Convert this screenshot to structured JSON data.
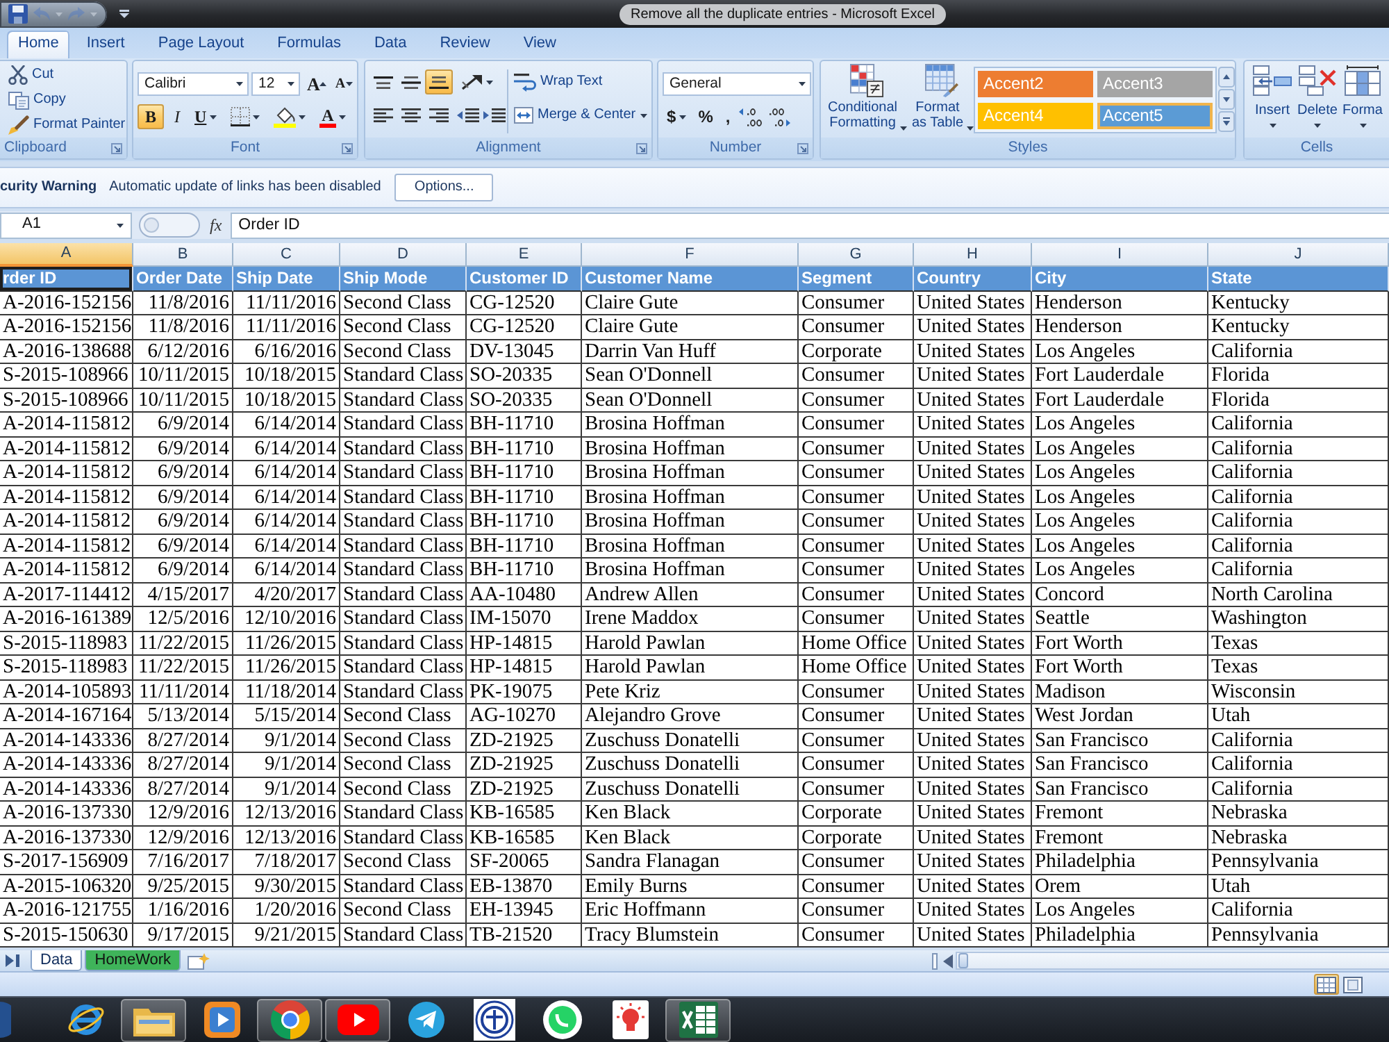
{
  "title_bar": {
    "title": "Remove all the duplicate entries - Microsoft Excel",
    "quick_access": [
      {
        "kind": "save",
        "disabled": false
      },
      {
        "kind": "undo",
        "disabled": true
      },
      {
        "kind": "redo",
        "disabled": true
      }
    ]
  },
  "ribbon": {
    "tabs": [
      {
        "label": "Home",
        "selected": true
      },
      {
        "label": "Insert",
        "selected": false
      },
      {
        "label": "Page Layout",
        "selected": false
      },
      {
        "label": "Formulas",
        "selected": false
      },
      {
        "label": "Data",
        "selected": false
      },
      {
        "label": "Review",
        "selected": false
      },
      {
        "label": "View",
        "selected": false
      }
    ],
    "clipboard": {
      "label": "Clipboard",
      "commands": [
        {
          "kind": "cut",
          "label": "Cut"
        },
        {
          "kind": "copy",
          "label": "Copy"
        },
        {
          "kind": "format_painter",
          "label": "Format Painter"
        }
      ]
    },
    "font": {
      "label": "Font",
      "font_name": "Calibri",
      "font_size": "12",
      "grow_label": "A",
      "shrink_label": "A",
      "styles": [
        {
          "kind": "bold",
          "label": "B",
          "selected": true
        },
        {
          "kind": "italic",
          "label": "I",
          "selected": false
        },
        {
          "kind": "underline",
          "label": "U",
          "selected": false
        }
      ],
      "font_color_label": "A"
    },
    "alignment": {
      "label": "Alignment",
      "vertical": [
        {
          "kind": "top",
          "selected": false
        },
        {
          "kind": "middle",
          "selected": false
        },
        {
          "kind": "bottom",
          "selected": true
        }
      ],
      "horizontal": [
        {
          "kind": "left",
          "selected": false
        },
        {
          "kind": "center",
          "selected": false
        },
        {
          "kind": "right",
          "selected": false
        }
      ],
      "wrap_text": "Wrap Text",
      "merge": "Merge & Center"
    },
    "number": {
      "label": "Number",
      "format": "General",
      "symbols": [
        {
          "kind": "currency",
          "label": "$"
        },
        {
          "kind": "percent",
          "label": "%"
        },
        {
          "kind": "comma",
          "label": ","
        }
      ]
    },
    "styles": {
      "label": "Styles",
      "conditional": "Conditional Formatting",
      "format_table": "Format as Table",
      "gallery": [
        {
          "label": "Accent2",
          "color": "#ed7d31",
          "selected": false
        },
        {
          "label": "Accent3",
          "color": "#a5a5a5",
          "selected": false
        },
        {
          "label": "Accent4",
          "color": "#ffc000",
          "selected": false
        },
        {
          "label": "Accent5",
          "color": "#5b9bd5",
          "selected": true
        }
      ]
    },
    "cells": {
      "label": "Cells",
      "commands": [
        {
          "kind": "insert",
          "label": "Insert"
        },
        {
          "kind": "delete",
          "label": "Delete"
        },
        {
          "kind": "format",
          "label": "Forma"
        }
      ]
    }
  },
  "security_bar": {
    "title": "curity Warning",
    "message": "Automatic update of links has been disabled",
    "button": "Options..."
  },
  "formula_bar": {
    "name_box": "A1",
    "function_label": "fx",
    "content": "Order ID"
  },
  "sheet": {
    "columns": [
      {
        "letter": "A",
        "header": "rder ID",
        "kind": "text",
        "selected": true
      },
      {
        "letter": "B",
        "header": "Order Date",
        "kind": "date",
        "selected": false
      },
      {
        "letter": "C",
        "header": "Ship Date",
        "kind": "date",
        "selected": false
      },
      {
        "letter": "D",
        "header": "Ship Mode",
        "kind": "text",
        "selected": false
      },
      {
        "letter": "E",
        "header": "Customer ID",
        "kind": "text",
        "selected": false
      },
      {
        "letter": "F",
        "header": "Customer Name",
        "kind": "text",
        "selected": false
      },
      {
        "letter": "G",
        "header": "Segment",
        "kind": "text",
        "selected": false
      },
      {
        "letter": "H",
        "header": "Country",
        "kind": "text",
        "selected": false
      },
      {
        "letter": "I",
        "header": "City",
        "kind": "text",
        "selected": false
      },
      {
        "letter": "J",
        "header": "State",
        "kind": "text",
        "selected": false
      }
    ],
    "rows": [
      [
        "A-2016-152156",
        "11/8/2016",
        "11/11/2016",
        "Second Class",
        "CG-12520",
        "Claire Gute",
        "Consumer",
        "United States",
        "Henderson",
        "Kentucky"
      ],
      [
        "A-2016-152156",
        "11/8/2016",
        "11/11/2016",
        "Second Class",
        "CG-12520",
        "Claire Gute",
        "Consumer",
        "United States",
        "Henderson",
        "Kentucky"
      ],
      [
        "A-2016-138688",
        "6/12/2016",
        "6/16/2016",
        "Second Class",
        "DV-13045",
        "Darrin Van Huff",
        "Corporate",
        "United States",
        "Los Angeles",
        "California"
      ],
      [
        "S-2015-108966",
        "10/11/2015",
        "10/18/2015",
        "Standard Class",
        "SO-20335",
        "Sean O'Donnell",
        "Consumer",
        "United States",
        "Fort Lauderdale",
        "Florida"
      ],
      [
        "S-2015-108966",
        "10/11/2015",
        "10/18/2015",
        "Standard Class",
        "SO-20335",
        "Sean O'Donnell",
        "Consumer",
        "United States",
        "Fort Lauderdale",
        "Florida"
      ],
      [
        "A-2014-115812",
        "6/9/2014",
        "6/14/2014",
        "Standard Class",
        "BH-11710",
        "Brosina Hoffman",
        "Consumer",
        "United States",
        "Los Angeles",
        "California"
      ],
      [
        "A-2014-115812",
        "6/9/2014",
        "6/14/2014",
        "Standard Class",
        "BH-11710",
        "Brosina Hoffman",
        "Consumer",
        "United States",
        "Los Angeles",
        "California"
      ],
      [
        "A-2014-115812",
        "6/9/2014",
        "6/14/2014",
        "Standard Class",
        "BH-11710",
        "Brosina Hoffman",
        "Consumer",
        "United States",
        "Los Angeles",
        "California"
      ],
      [
        "A-2014-115812",
        "6/9/2014",
        "6/14/2014",
        "Standard Class",
        "BH-11710",
        "Brosina Hoffman",
        "Consumer",
        "United States",
        "Los Angeles",
        "California"
      ],
      [
        "A-2014-115812",
        "6/9/2014",
        "6/14/2014",
        "Standard Class",
        "BH-11710",
        "Brosina Hoffman",
        "Consumer",
        "United States",
        "Los Angeles",
        "California"
      ],
      [
        "A-2014-115812",
        "6/9/2014",
        "6/14/2014",
        "Standard Class",
        "BH-11710",
        "Brosina Hoffman",
        "Consumer",
        "United States",
        "Los Angeles",
        "California"
      ],
      [
        "A-2014-115812",
        "6/9/2014",
        "6/14/2014",
        "Standard Class",
        "BH-11710",
        "Brosina Hoffman",
        "Consumer",
        "United States",
        "Los Angeles",
        "California"
      ],
      [
        "A-2017-114412",
        "4/15/2017",
        "4/20/2017",
        "Standard Class",
        "AA-10480",
        "Andrew Allen",
        "Consumer",
        "United States",
        "Concord",
        "North Carolina"
      ],
      [
        "A-2016-161389",
        "12/5/2016",
        "12/10/2016",
        "Standard Class",
        "IM-15070",
        "Irene Maddox",
        "Consumer",
        "United States",
        "Seattle",
        "Washington"
      ],
      [
        "S-2015-118983",
        "11/22/2015",
        "11/26/2015",
        "Standard Class",
        "HP-14815",
        "Harold Pawlan",
        "Home Office",
        "United States",
        "Fort Worth",
        "Texas"
      ],
      [
        "S-2015-118983",
        "11/22/2015",
        "11/26/2015",
        "Standard Class",
        "HP-14815",
        "Harold Pawlan",
        "Home Office",
        "United States",
        "Fort Worth",
        "Texas"
      ],
      [
        "A-2014-105893",
        "11/11/2014",
        "11/18/2014",
        "Standard Class",
        "PK-19075",
        "Pete Kriz",
        "Consumer",
        "United States",
        "Madison",
        "Wisconsin"
      ],
      [
        "A-2014-167164",
        "5/13/2014",
        "5/15/2014",
        "Second Class",
        "AG-10270",
        "Alejandro Grove",
        "Consumer",
        "United States",
        "West Jordan",
        "Utah"
      ],
      [
        "A-2014-143336",
        "8/27/2014",
        "9/1/2014",
        "Second Class",
        "ZD-21925",
        "Zuschuss Donatelli",
        "Consumer",
        "United States",
        "San Francisco",
        "California"
      ],
      [
        "A-2014-143336",
        "8/27/2014",
        "9/1/2014",
        "Second Class",
        "ZD-21925",
        "Zuschuss Donatelli",
        "Consumer",
        "United States",
        "San Francisco",
        "California"
      ],
      [
        "A-2014-143336",
        "8/27/2014",
        "9/1/2014",
        "Second Class",
        "ZD-21925",
        "Zuschuss Donatelli",
        "Consumer",
        "United States",
        "San Francisco",
        "California"
      ],
      [
        "A-2016-137330",
        "12/9/2016",
        "12/13/2016",
        "Standard Class",
        "KB-16585",
        "Ken Black",
        "Corporate",
        "United States",
        "Fremont",
        "Nebraska"
      ],
      [
        "A-2016-137330",
        "12/9/2016",
        "12/13/2016",
        "Standard Class",
        "KB-16585",
        "Ken Black",
        "Corporate",
        "United States",
        "Fremont",
        "Nebraska"
      ],
      [
        "S-2017-156909",
        "7/16/2017",
        "7/18/2017",
        "Second Class",
        "SF-20065",
        "Sandra Flanagan",
        "Consumer",
        "United States",
        "Philadelphia",
        "Pennsylvania"
      ],
      [
        "A-2015-106320",
        "9/25/2015",
        "9/30/2015",
        "Standard Class",
        "EB-13870",
        "Emily Burns",
        "Consumer",
        "United States",
        "Orem",
        "Utah"
      ],
      [
        "A-2016-121755",
        "1/16/2016",
        "1/20/2016",
        "Second Class",
        "EH-13945",
        "Eric Hoffmann",
        "Consumer",
        "United States",
        "Los Angeles",
        "California"
      ],
      [
        "S-2015-150630",
        "9/17/2015",
        "9/21/2015",
        "Standard Class",
        "TB-21520",
        "Tracy Blumstein",
        "Consumer",
        "United States",
        "Philadelphia",
        "Pennsylvania"
      ]
    ]
  },
  "sheet_tabs": [
    {
      "label": "Data",
      "selected": true
    },
    {
      "label": "HomeWork",
      "selected": false,
      "color": "#3fb45a"
    }
  ],
  "status_bar": {
    "views": [
      {
        "kind": "normal",
        "selected": true
      },
      {
        "kind": "page_layout",
        "selected": false
      }
    ]
  },
  "taskbar": {
    "apps": [
      {
        "kind": "browser_e",
        "open": false
      },
      {
        "kind": "folder",
        "open": true
      },
      {
        "kind": "media",
        "open": false
      },
      {
        "kind": "round_browser",
        "open": true
      },
      {
        "kind": "video",
        "open": true
      },
      {
        "kind": "messenger",
        "open": false
      },
      {
        "kind": "emblem",
        "open": false
      },
      {
        "kind": "chat",
        "open": false
      },
      {
        "kind": "bulb",
        "open": false
      },
      {
        "kind": "spreadsheet",
        "open": true
      }
    ]
  }
}
